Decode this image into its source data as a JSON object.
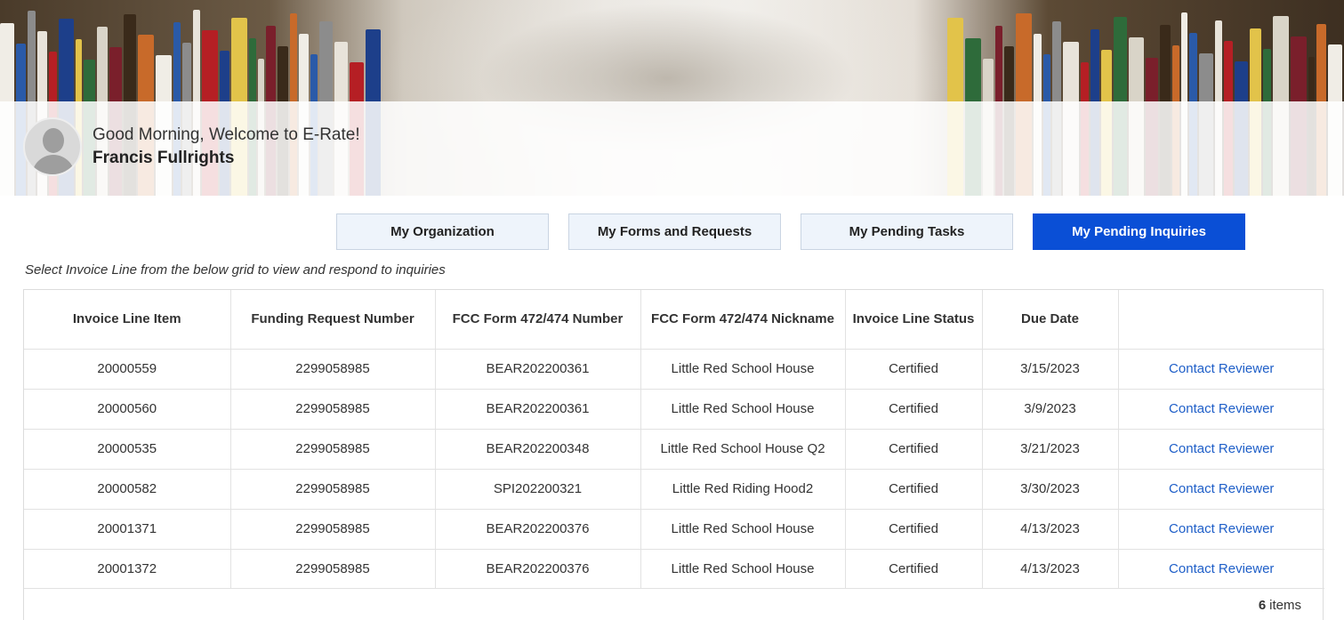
{
  "greeting": {
    "welcome_text": "Good Morning, Welcome to E-Rate!",
    "user_name": "Francis Fullrights"
  },
  "tabs": [
    {
      "label": "My Organization",
      "active": false
    },
    {
      "label": "My Forms and Requests",
      "active": false
    },
    {
      "label": "My Pending Tasks",
      "active": false
    },
    {
      "label": "My Pending Inquiries",
      "active": true
    }
  ],
  "instruction": "Select Invoice Line from the below grid to view and respond to inquiries",
  "grid": {
    "columns": [
      "Invoice Line Item",
      "Funding Request Number",
      "FCC Form 472/474 Number",
      "FCC Form 472/474 Nickname",
      "Invoice Line Status",
      "Due Date",
      ""
    ],
    "rows": [
      {
        "invoice_line_item": "20000559",
        "frn": "2299058985",
        "form_number": "BEAR202200361",
        "nickname": "Little Red School House",
        "status": "Certified",
        "due_date": "3/15/2023",
        "action": "Contact Reviewer"
      },
      {
        "invoice_line_item": "20000560",
        "frn": "2299058985",
        "form_number": "BEAR202200361",
        "nickname": "Little Red School House",
        "status": "Certified",
        "due_date": "3/9/2023",
        "action": "Contact Reviewer"
      },
      {
        "invoice_line_item": "20000535",
        "frn": "2299058985",
        "form_number": "BEAR202200348",
        "nickname": "Little Red School House Q2",
        "status": "Certified",
        "due_date": "3/21/2023",
        "action": "Contact Reviewer"
      },
      {
        "invoice_line_item": "20000582",
        "frn": "2299058985",
        "form_number": "SPI202200321",
        "nickname": "Little Red Riding Hood2",
        "status": "Certified",
        "due_date": "3/30/2023",
        "action": "Contact Reviewer"
      },
      {
        "invoice_line_item": "20001371",
        "frn": "2299058985",
        "form_number": "BEAR202200376",
        "nickname": "Little Red School House",
        "status": "Certified",
        "due_date": "4/13/2023",
        "action": "Contact Reviewer"
      },
      {
        "invoice_line_item": "20001372",
        "frn": "2299058985",
        "form_number": "BEAR202200376",
        "nickname": "Little Red School House",
        "status": "Certified",
        "due_date": "4/13/2023",
        "action": "Contact Reviewer"
      }
    ],
    "item_count": "6",
    "item_count_suffix": "items"
  },
  "colors": {
    "active_tab": "#0a4fd6",
    "inactive_tab": "#eef4fb",
    "link": "#1f5fc8"
  }
}
